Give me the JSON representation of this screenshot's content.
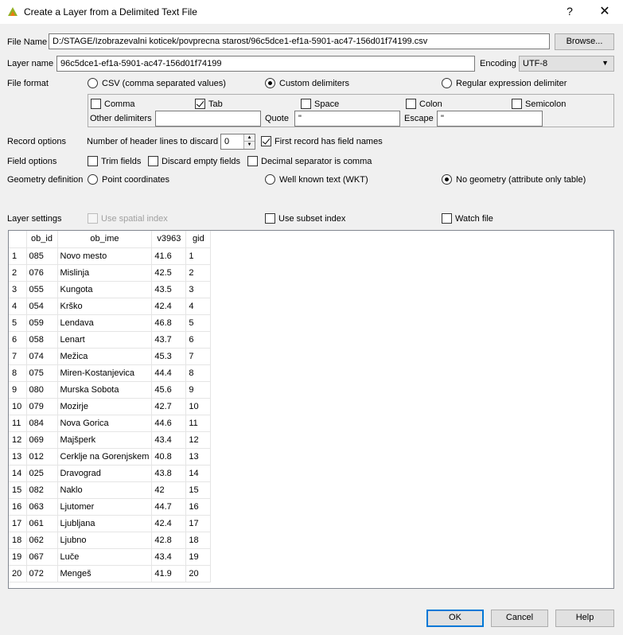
{
  "window": {
    "title": "Create a Layer from a Delimited Text File",
    "help": "?",
    "close": "✕"
  },
  "file_name": {
    "label": "File Name",
    "value": "D:/STAGE/Izobrazevalni koticek/povprecna starost/96c5dce1-ef1a-5901-ac47-156d01f74199.csv",
    "browse": "Browse..."
  },
  "layer_name": {
    "label": "Layer name",
    "value": "96c5dce1-ef1a-5901-ac47-156d01f74199",
    "encoding_label": "Encoding",
    "encoding_value": "UTF-8"
  },
  "file_format": {
    "label": "File format",
    "options": [
      "CSV (comma separated values)",
      "Custom delimiters",
      "Regular expression delimiter"
    ],
    "selected": "Custom delimiters"
  },
  "delimiters": {
    "comma": "Comma",
    "tab": "Tab",
    "space": "Space",
    "colon": "Colon",
    "semicolon": "Semicolon",
    "other_label": "Other delimiters",
    "other_value": "",
    "quote_label": "Quote",
    "quote_value": "\"",
    "escape_label": "Escape",
    "escape_value": "\""
  },
  "record_options": {
    "label": "Record options",
    "header_lines_label": "Number of header lines to discard",
    "header_lines_value": "0",
    "first_record_label": "First record has field names"
  },
  "field_options": {
    "label": "Field options",
    "trim": "Trim fields",
    "discard_empty": "Discard empty fields",
    "decimal_comma": "Decimal separator is comma"
  },
  "geometry": {
    "label": "Geometry definition",
    "point": "Point coordinates",
    "wkt": "Well known text (WKT)",
    "none": "No geometry (attribute only table)"
  },
  "layer_settings": {
    "label": "Layer settings",
    "spatial_index": "Use spatial index",
    "subset_index": "Use subset index",
    "watch_file": "Watch file"
  },
  "table": {
    "columns": [
      "ob_id",
      "ob_ime",
      "v3963",
      "gid"
    ],
    "rows": [
      [
        "1",
        "085",
        "Novo mesto",
        "41.6",
        "1"
      ],
      [
        "2",
        "076",
        "Mislinja",
        "42.5",
        "2"
      ],
      [
        "3",
        "055",
        "Kungota",
        "43.5",
        "3"
      ],
      [
        "4",
        "054",
        "Krško",
        "42.4",
        "4"
      ],
      [
        "5",
        "059",
        "Lendava",
        "46.8",
        "5"
      ],
      [
        "6",
        "058",
        "Lenart",
        "43.7",
        "6"
      ],
      [
        "7",
        "074",
        "Mežica",
        "45.3",
        "7"
      ],
      [
        "8",
        "075",
        "Miren-Kostanjevica",
        "44.4",
        "8"
      ],
      [
        "9",
        "080",
        "Murska Sobota",
        "45.6",
        "9"
      ],
      [
        "10",
        "079",
        "Mozirje",
        "42.7",
        "10"
      ],
      [
        "11",
        "084",
        "Nova Gorica",
        "44.6",
        "11"
      ],
      [
        "12",
        "069",
        "Majšperk",
        "43.4",
        "12"
      ],
      [
        "13",
        "012",
        "Cerklje na Gorenjskem",
        "40.8",
        "13"
      ],
      [
        "14",
        "025",
        "Dravograd",
        "43.8",
        "14"
      ],
      [
        "15",
        "082",
        "Naklo",
        "42",
        "15"
      ],
      [
        "16",
        "063",
        "Ljutomer",
        "44.7",
        "16"
      ],
      [
        "17",
        "061",
        "Ljubljana",
        "42.4",
        "17"
      ],
      [
        "18",
        "062",
        "Ljubno",
        "42.8",
        "18"
      ],
      [
        "19",
        "067",
        "Luče",
        "43.4",
        "19"
      ],
      [
        "20",
        "072",
        "Mengeš",
        "41.9",
        "20"
      ]
    ]
  },
  "buttons": {
    "ok": "OK",
    "cancel": "Cancel",
    "help": "Help"
  }
}
